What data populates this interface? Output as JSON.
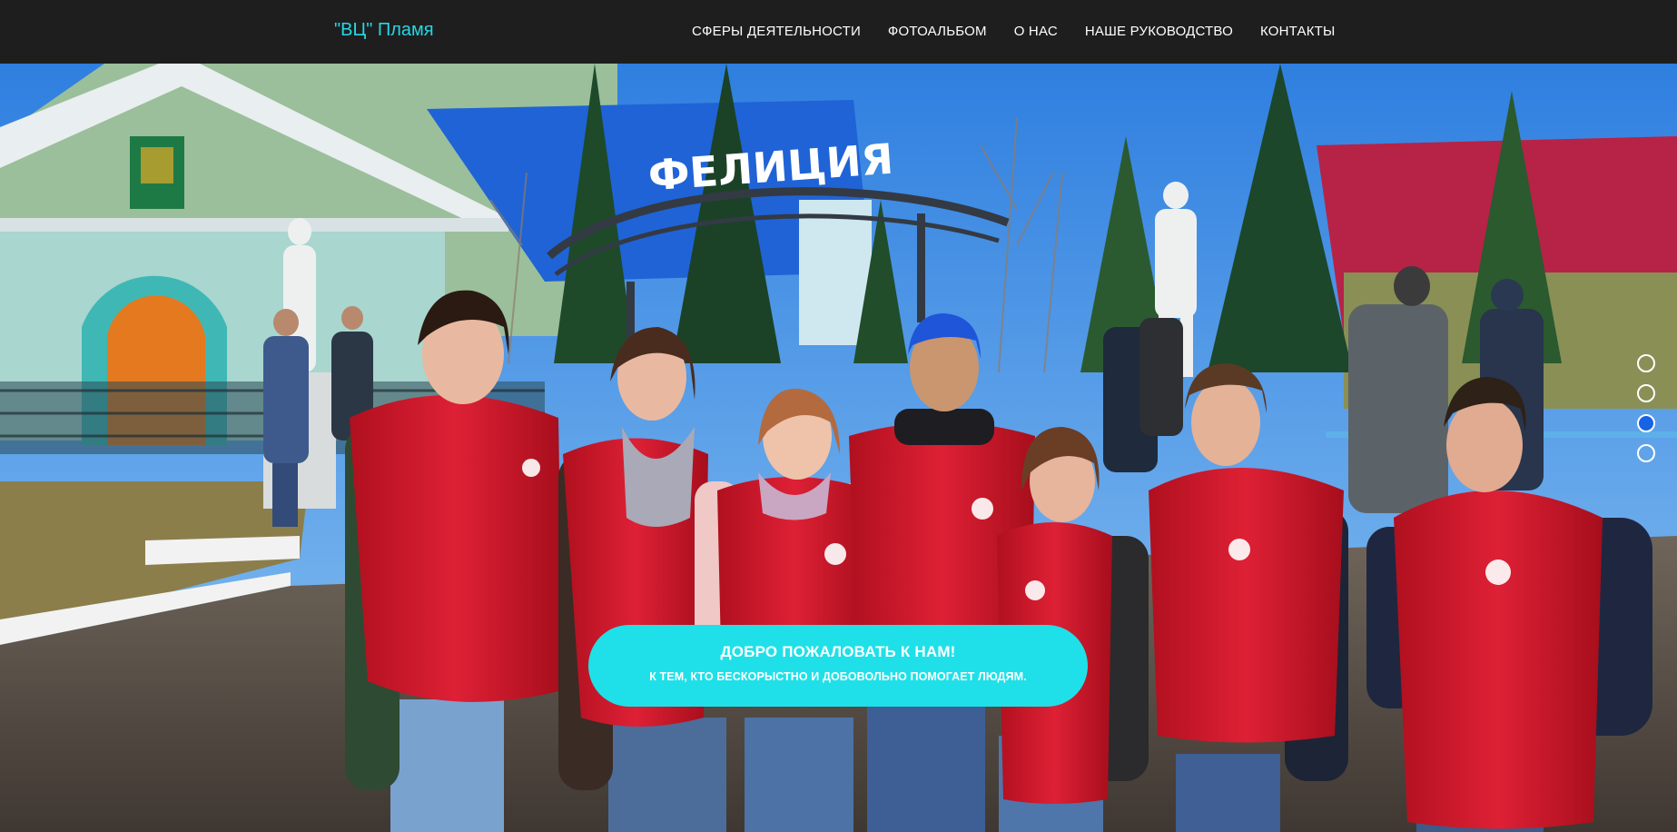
{
  "header": {
    "brand": "\"ВЦ\" Пламя",
    "menu": [
      {
        "label": "СФЕРЫ ДЕЯТЕЛЬНОСТИ"
      },
      {
        "label": "ФОТОАЛЬБОМ"
      },
      {
        "label": "О НАС"
      },
      {
        "label": "НАШЕ РУКОВОДСТВО"
      },
      {
        "label": "КОНТАКТЫ"
      }
    ]
  },
  "hero": {
    "photo_sign": "ФЕЛИЦИЯ",
    "welcome_title": "ДОБРО ПОЖАЛОВАТЬ К НАМ!",
    "welcome_subtitle": "К ТЕМ, КТО БЕСКОРЫСТНО И ДОБОВОЛЬНО ПОМОГАЕТ ЛЮДЯМ.",
    "slider": {
      "count": 4,
      "active_index": 2
    }
  },
  "colors": {
    "navbar_bg": "#1e1e1e",
    "brand": "#25d7e6",
    "welcome_bg": "#1fe0e8",
    "active_dot": "#1763e6",
    "vest_red": "#d3192f"
  }
}
